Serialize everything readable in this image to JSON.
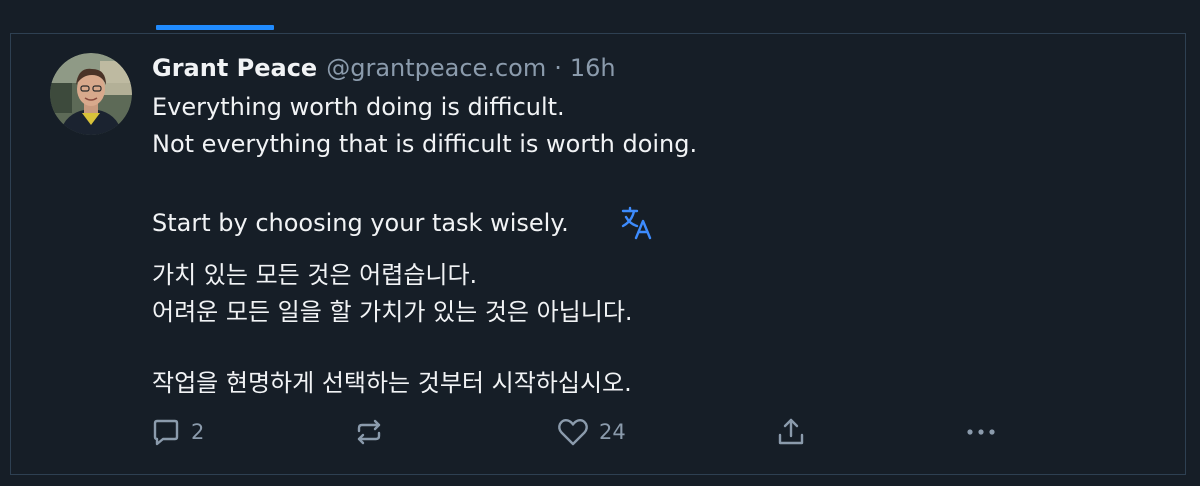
{
  "colors": {
    "background": "#161e27",
    "border": "#2e4052",
    "accent": "#208bfe",
    "muted_text": "#8b9bac",
    "primary_text": "#f1f3f5"
  },
  "post": {
    "author": {
      "display_name": "Grant Peace",
      "handle": "@grantpeace.com",
      "avatar_icon": "avatar-photo"
    },
    "separator": "·",
    "timestamp": "16h",
    "text_lines": [
      "Everything worth doing is difficult.",
      "Not everything that is difficult is worth doing.",
      "Start by choosing your task wisely."
    ],
    "translate_icon": "translate-icon",
    "translation_lines": [
      "가치 있는 모든 것은 어렵습니다.",
      "어려운 모든 일을 할 가치가 있는 것은 아닙니다.",
      "작업을 현명하게 선택하는 것부터 시작하십시오."
    ],
    "actions": {
      "reply_count": "2",
      "repost_count": "",
      "like_count": "24"
    }
  }
}
